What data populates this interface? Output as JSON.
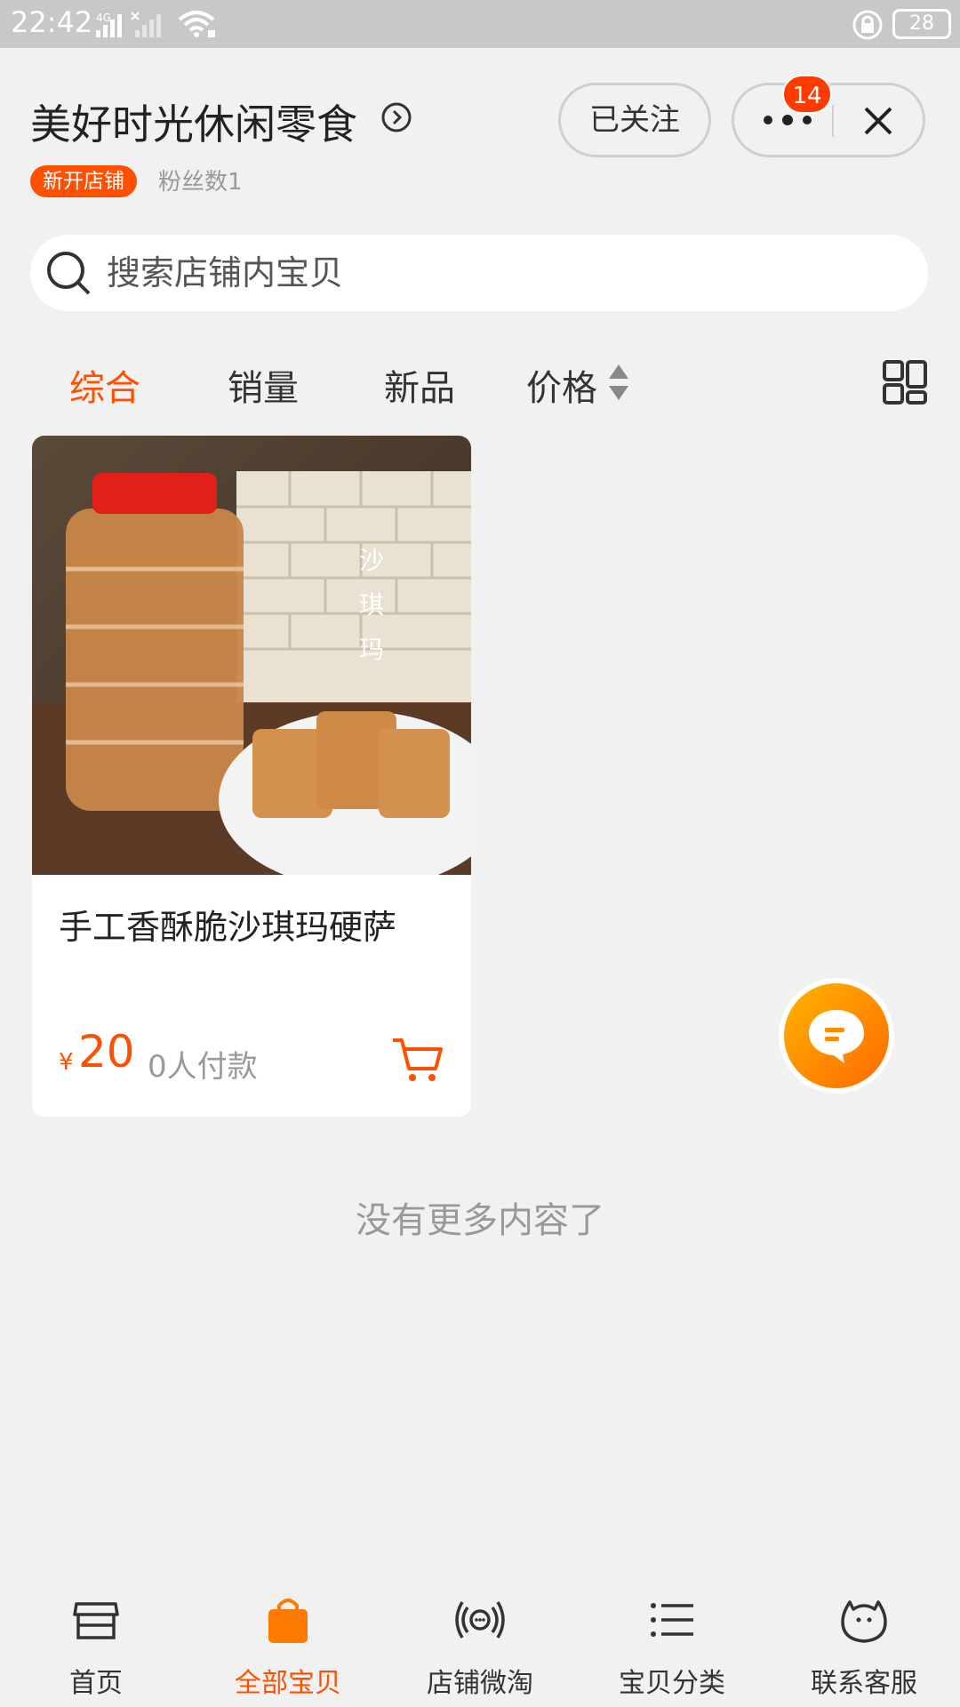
{
  "status_bar": {
    "time": "22:42",
    "network": "4G",
    "battery": "28"
  },
  "header": {
    "shop_name": "美好时光休闲零食",
    "new_shop_badge": "新开店铺",
    "fans": "粉丝数1",
    "follow_label": "已关注",
    "message_count": "14"
  },
  "search": {
    "placeholder": "搜索店铺内宝贝"
  },
  "sort_tabs": [
    {
      "label": "综合",
      "active": true
    },
    {
      "label": "销量",
      "active": false
    },
    {
      "label": "新品",
      "active": false
    },
    {
      "label": "价格",
      "active": false
    }
  ],
  "products": [
    {
      "name": "手工香酥脆沙琪玛硬萨",
      "currency": "¥",
      "price": "20",
      "sold": "0人付款",
      "image_text": "沙\n琪\n玛"
    }
  ],
  "list_end_text": "没有更多内容了",
  "bottom_nav": [
    {
      "label": "首页",
      "icon": "shop-front-icon",
      "active": false
    },
    {
      "label": "全部宝贝",
      "icon": "shopping-bag-icon",
      "active": true
    },
    {
      "label": "店铺微淘",
      "icon": "broadcast-icon",
      "active": false
    },
    {
      "label": "宝贝分类",
      "icon": "list-icon",
      "active": false
    },
    {
      "label": "联系客服",
      "icon": "service-face-icon",
      "active": false
    }
  ],
  "colors": {
    "accent": "#ff5000",
    "background": "#f1f1f1",
    "status_bar": "#c8c8c8"
  }
}
